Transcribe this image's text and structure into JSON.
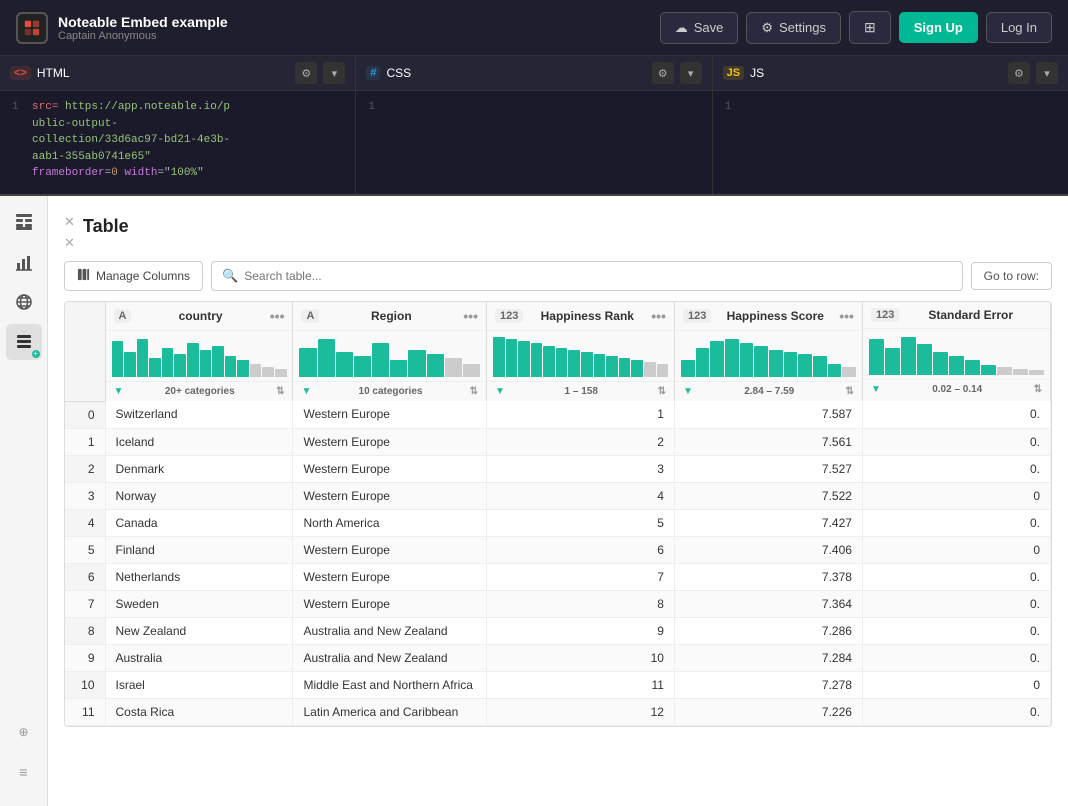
{
  "topbar": {
    "logo_text": "N",
    "app_title": "Noteable Embed example",
    "app_subtitle": "Captain Anonymous",
    "save_label": "Save",
    "settings_label": "Settings",
    "signup_label": "Sign Up",
    "login_label": "Log In"
  },
  "editors": [
    {
      "id": "html",
      "tab_label": "HTML",
      "tab_icon": "HTML",
      "line_number": "1",
      "code": "src= https://app.noteable.io/public-output-collection/33d6ac97-bd21-4e3b-aab1-355ab0741e65\" frameborder=0 width=\"100%\""
    },
    {
      "id": "css",
      "tab_label": "CSS",
      "tab_icon": "CSS",
      "line_number": "1",
      "code": ""
    },
    {
      "id": "js",
      "tab_label": "JS",
      "tab_icon": "JS",
      "line_number": "1",
      "code": ""
    }
  ],
  "sidebar": {
    "icons": [
      "table",
      "chart",
      "globe",
      "data-active",
      "plus"
    ]
  },
  "table": {
    "title": "Table",
    "manage_cols_label": "Manage Columns",
    "search_placeholder": "Search table...",
    "goto_row_label": "Go to row:",
    "columns": [
      {
        "id": "country",
        "type": "A",
        "name": "country",
        "filter_label": "20+ categories",
        "range": ""
      },
      {
        "id": "region",
        "type": "A",
        "name": "Region",
        "filter_label": "10 categories",
        "range": ""
      },
      {
        "id": "happiness_rank",
        "type": "123",
        "name": "Happiness Rank",
        "filter_label": "1 – 158",
        "range": ""
      },
      {
        "id": "happiness_score",
        "type": "123",
        "name": "Happiness Score",
        "filter_label": "2.84 – 7.59",
        "range": ""
      },
      {
        "id": "standard_error",
        "type": "123",
        "name": "Standard Error",
        "filter_label": "0.02 – 0.14",
        "range": ""
      }
    ],
    "rows": [
      {
        "idx": 0,
        "country": "Switzerland",
        "region": "Western Europe",
        "happiness_rank": 1,
        "happiness_score": "7.587",
        "standard_error": "0."
      },
      {
        "idx": 1,
        "country": "Iceland",
        "region": "Western Europe",
        "happiness_rank": 2,
        "happiness_score": "7.561",
        "standard_error": "0."
      },
      {
        "idx": 2,
        "country": "Denmark",
        "region": "Western Europe",
        "happiness_rank": 3,
        "happiness_score": "7.527",
        "standard_error": "0."
      },
      {
        "idx": 3,
        "country": "Norway",
        "region": "Western Europe",
        "happiness_rank": 4,
        "happiness_score": "7.522",
        "standard_error": "0"
      },
      {
        "idx": 4,
        "country": "Canada",
        "region": "North America",
        "happiness_rank": 5,
        "happiness_score": "7.427",
        "standard_error": "0."
      },
      {
        "idx": 5,
        "country": "Finland",
        "region": "Western Europe",
        "happiness_rank": 6,
        "happiness_score": "7.406",
        "standard_error": "0"
      },
      {
        "idx": 6,
        "country": "Netherlands",
        "region": "Western Europe",
        "happiness_rank": 7,
        "happiness_score": "7.378",
        "standard_error": "0."
      },
      {
        "idx": 7,
        "country": "Sweden",
        "region": "Western Europe",
        "happiness_rank": 8,
        "happiness_score": "7.364",
        "standard_error": "0."
      },
      {
        "idx": 8,
        "country": "New Zealand",
        "region": "Australia and New Zealand",
        "happiness_rank": 9,
        "happiness_score": "7.286",
        "standard_error": "0."
      },
      {
        "idx": 9,
        "country": "Australia",
        "region": "Australia and New Zealand",
        "happiness_rank": 10,
        "happiness_score": "7.284",
        "standard_error": "0."
      },
      {
        "idx": 10,
        "country": "Israel",
        "region": "Middle East and Northern Africa",
        "happiness_rank": 11,
        "happiness_score": "7.278",
        "standard_error": "0"
      },
      {
        "idx": 11,
        "country": "Costa Rica",
        "region": "Latin America and Caribbean",
        "happiness_rank": 12,
        "happiness_score": "7.226",
        "standard_error": "0."
      }
    ]
  }
}
